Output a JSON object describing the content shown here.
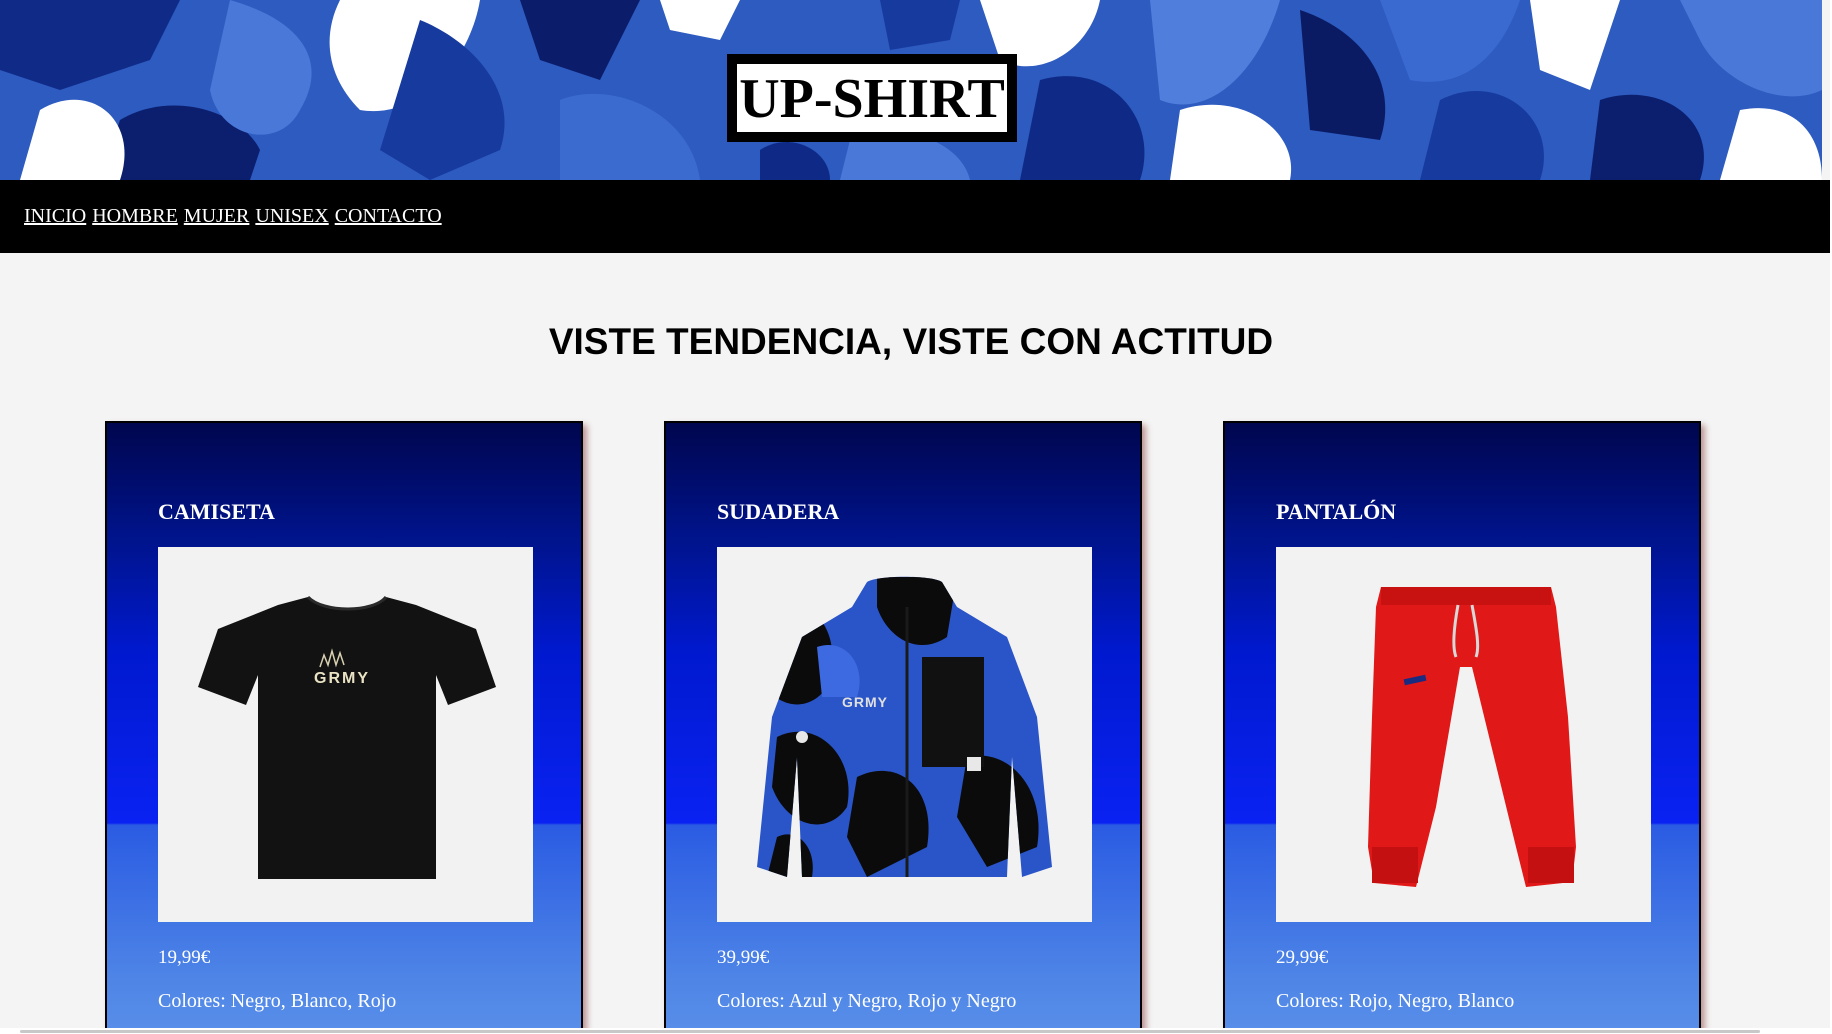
{
  "header": {
    "logo_text": "UP-SHIRT"
  },
  "nav": {
    "items": [
      {
        "label": "INICIO"
      },
      {
        "label": "HOMBRE"
      },
      {
        "label": "MUJER"
      },
      {
        "label": "UNISEX"
      },
      {
        "label": "CONTACTO"
      }
    ]
  },
  "main": {
    "tagline": "VISTE TENDENCIA, VISTE CON ACTITUD",
    "products": [
      {
        "title": "CAMISETA",
        "price": "19,99€",
        "colors": "Colores: Negro, Blanco, Rojo",
        "image_icon": "black-tshirt-image"
      },
      {
        "title": "SUDADERA",
        "price": "39,99€",
        "colors": "Colores: Azul y Negro, Rojo y Negro",
        "image_icon": "camo-zip-jacket-image"
      },
      {
        "title": "PANTALÓN",
        "price": "29,99€",
        "colors": "Colores: Rojo, Negro, Blanco",
        "image_icon": "red-sweatpants-image"
      }
    ]
  },
  "theme": {
    "nav_bg": "#000000",
    "page_bg": "#f4f4f4",
    "card_top": "#00064e",
    "card_mid": "#0a22f2",
    "card_bottom": "#5b90ea",
    "text_on_card": "#ffffff"
  }
}
